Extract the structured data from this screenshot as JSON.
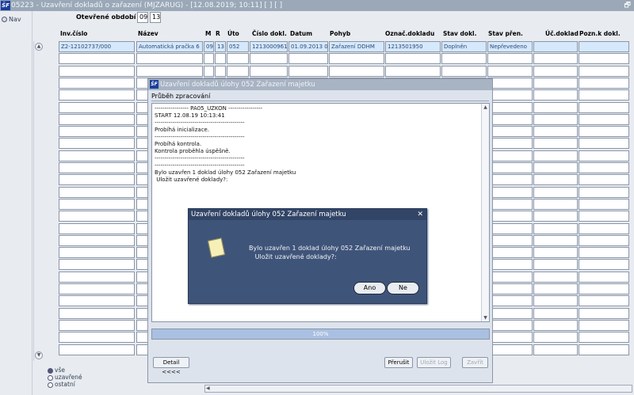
{
  "window": {
    "title": "05223 - Uzavření dokladů o zařazení (MJZARUG) - [12.08.2019; 10:11]  [ ]  [ ]",
    "app_icon": "ŠF",
    "restore": "🗗"
  },
  "nav": {
    "label": "Nav"
  },
  "period": {
    "label": "Otevřené období",
    "month": "09",
    "year": "13"
  },
  "table": {
    "headers": {
      "inv": "Inv.číslo",
      "nazev": "Název",
      "m": "M",
      "r": "R",
      "uto": "Úto",
      "cislo": "Číslo dokl.",
      "datum": "Datum",
      "pohyb": "Pohyb",
      "oznac": "Označ.dokladu",
      "stav_dokl": "Stav dokl.",
      "stav_pren": "Stav přen.",
      "uc": "Úč.doklad",
      "pozn": "Pozn.k dokl."
    },
    "row1": {
      "inv": "Z2-12102737/000",
      "nazev": "Automatická pračka 6",
      "m": "09",
      "r": "13",
      "uto": "052",
      "cislo": "1213000961",
      "datum": "01.09.2013 0",
      "pohyb": "Zařazení DDHM",
      "oznac": "1213501950",
      "stav_dokl": "Doplněn",
      "stav_pren": "Nepřevedeno",
      "uc": "",
      "pozn": ""
    }
  },
  "filters": {
    "opt1": "vše",
    "opt2": "uzavřené",
    "opt3": "ostatní"
  },
  "progress_dialog": {
    "title": "Uzavření dokladů úlohy 052 Zařazení majetku",
    "subtitle": "Průběh zpracování",
    "log": [
      "----------------- PA05_UZKON -----------------",
      "START 12.08.19 10:13:41",
      "---------------------------------------------",
      "Probíhá inicializace.",
      "---------------------------------------------",
      "Probíhá kontrola.",
      "Kontrola proběhla úspěšně.",
      "---------------------------------------------",
      "---------------------------------------------",
      "Bylo uzavřen 1 doklad úlohy 052 Zařazení majetku",
      " Uložit uzavřené doklady?:"
    ],
    "progress": "100%",
    "buttons": {
      "detail": "Detail <<<<",
      "prerusit": "Přerušit",
      "ulozit_log": "Uložit Log",
      "zavrit": "Zavřít"
    }
  },
  "confirm_dialog": {
    "title": "Uzavření dokladů úlohy 052 Zařazení majetku",
    "message": "Bylo uzavřen 1 doklad úlohy 052 Zařazení majetku\n   Uložit uzavřené doklady?:",
    "yes": "Ano",
    "no": "Ne",
    "close": "✕"
  }
}
